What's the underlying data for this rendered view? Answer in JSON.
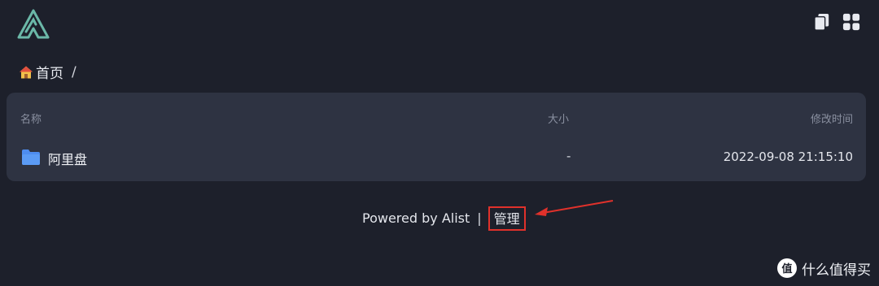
{
  "app": {
    "logo_icon": "alist-logo-icon"
  },
  "toolbar": {
    "copy_icon": "copy-icon",
    "grid_icon": "grid-view-icon"
  },
  "breadcrumb": {
    "home_icon": "home-icon",
    "home_label": "首页",
    "separator": "/"
  },
  "file_list": {
    "headers": {
      "name": "名称",
      "size": "大小",
      "modified": "修改时间"
    },
    "rows": [
      {
        "icon": "folder-icon",
        "name": "阿里盘",
        "size": "-",
        "modified": "2022-09-08 21:15:10"
      }
    ]
  },
  "footer": {
    "powered_by": "Powered by Alist",
    "separator": "|",
    "admin_label": "管理"
  },
  "watermark": {
    "logo_icon": "zhidemai-logo-icon",
    "text": "什么值得买"
  },
  "colors": {
    "background": "#1d202b",
    "panel": "#2e3342",
    "folder": "#4e8df0",
    "logo": "#6bb8a8",
    "annotation_red": "#e0312b"
  }
}
